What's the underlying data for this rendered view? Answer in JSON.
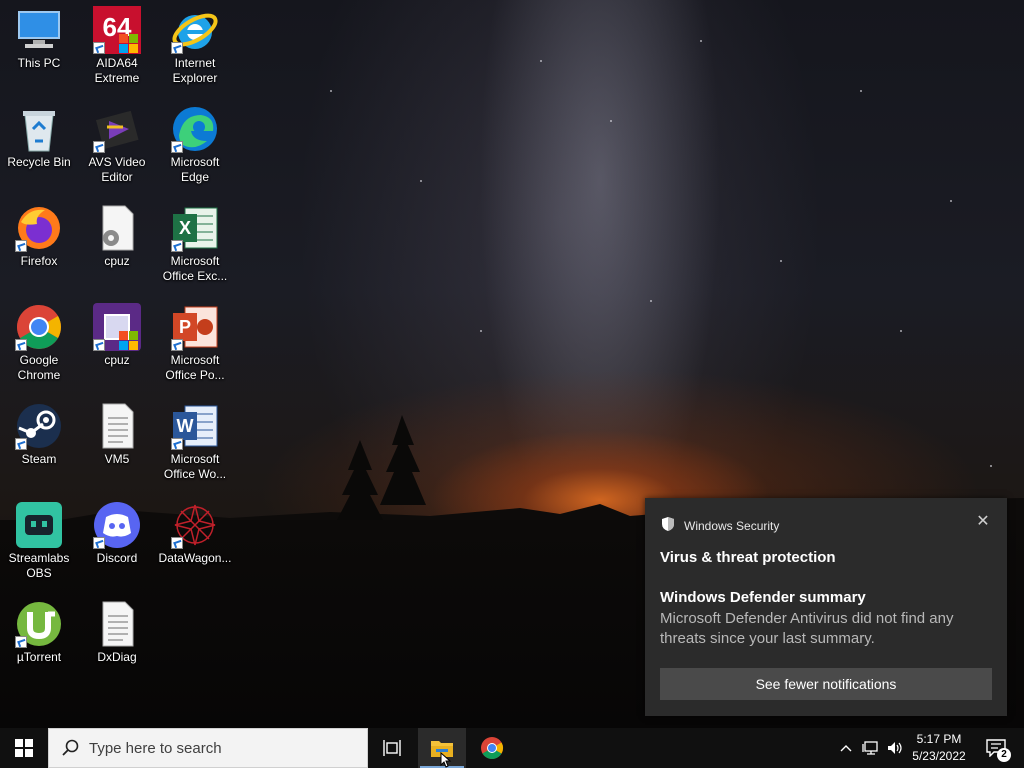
{
  "desktop_icons": [
    {
      "id": "this-pc",
      "label": "This PC",
      "icon": "computer-icon"
    },
    {
      "id": "aida64",
      "label": "AIDA64 Extreme",
      "icon": "aida64-icon"
    },
    {
      "id": "ie",
      "label": "Internet Explorer",
      "icon": "internet-explorer-icon"
    },
    {
      "id": "recycle",
      "label": "Recycle Bin",
      "icon": "recycle-bin-icon"
    },
    {
      "id": "avs",
      "label": "AVS Video Editor",
      "icon": "avs-video-editor-icon"
    },
    {
      "id": "edge",
      "label": "Microsoft Edge",
      "icon": "edge-icon"
    },
    {
      "id": "firefox",
      "label": "Firefox",
      "icon": "firefox-icon"
    },
    {
      "id": "cpuz-file",
      "label": "cpuz",
      "icon": "settings-file-icon"
    },
    {
      "id": "excel",
      "label": "Microsoft Office Exc...",
      "icon": "excel-icon"
    },
    {
      "id": "chrome",
      "label": "Google Chrome",
      "icon": "chrome-icon"
    },
    {
      "id": "cpuz-app",
      "label": "cpuz",
      "icon": "cpuz-icon"
    },
    {
      "id": "powerpoint",
      "label": "Microsoft Office Po...",
      "icon": "powerpoint-icon"
    },
    {
      "id": "steam",
      "label": "Steam",
      "icon": "steam-icon"
    },
    {
      "id": "vm5",
      "label": "VM5",
      "icon": "text-file-icon"
    },
    {
      "id": "word",
      "label": "Microsoft Office Wo...",
      "icon": "word-icon"
    },
    {
      "id": "streamlabs",
      "label": "Streamlabs OBS",
      "icon": "streamlabs-icon"
    },
    {
      "id": "discord",
      "label": "Discord",
      "icon": "discord-icon"
    },
    {
      "id": "datawagon",
      "label": "DataWagon...",
      "icon": "datawagon-icon"
    },
    {
      "id": "utorrent",
      "label": "µTorrent",
      "icon": "utorrent-icon"
    },
    {
      "id": "dxdiag",
      "label": "DxDiag",
      "icon": "text-file-icon"
    }
  ],
  "toast": {
    "app_name": "Windows Security",
    "heading": "Virus & threat protection",
    "title": "Windows Defender summary",
    "body": "Microsoft Defender Antivirus did not find any threats since your last summary.",
    "button": "See fewer notifications",
    "close": "✕"
  },
  "taskbar": {
    "search_placeholder": "Type here to search",
    "clock_time": "5:17 PM",
    "clock_date": "5/23/2022",
    "notification_count": "2",
    "tray_chevron": "^"
  },
  "colors": {
    "taskbar": "#101010",
    "toast_bg": "#2b2b2b",
    "toast_button": "#4a4a4a",
    "accent": "#7aa7d8"
  }
}
